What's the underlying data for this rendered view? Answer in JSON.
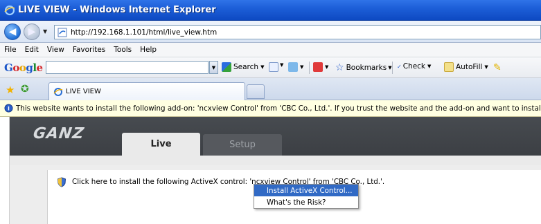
{
  "window": {
    "title": "LIVE VIEW - Windows Internet Explorer"
  },
  "address": {
    "url": "http://192.168.1.101/html/live_view.htm"
  },
  "menu": {
    "items": [
      "File",
      "Edit",
      "View",
      "Favorites",
      "Tools",
      "Help"
    ]
  },
  "google_toolbar": {
    "logo": "Google",
    "search_label": "Search",
    "bookmarks_label": "Bookmarks",
    "check_label": "Check",
    "autofill_label": "AutoFill"
  },
  "tabs": {
    "active_tab_label": "LIVE VIEW"
  },
  "infobar": {
    "message": "This website wants to install the following add-on: 'ncxview Control' from 'CBC Co., Ltd.'. If you trust the website and the add-on and want to install it, click here..."
  },
  "ganz": {
    "logo": "GANZ",
    "tab_live": "Live",
    "tab_setup": "Setup"
  },
  "activex": {
    "message": "Click here to install the following ActiveX control: 'ncxview Control' from 'CBC Co., Ltd.'."
  },
  "context_menu": {
    "items": [
      "Install ActiveX Control...",
      "What's the Risk?"
    ],
    "selected_index": 0
  },
  "colors": {
    "titlebar": "#1d5fd8",
    "infobar_bg": "#ffffe1",
    "ganz_header": "#474b50",
    "menu_highlight": "#316ac5"
  }
}
